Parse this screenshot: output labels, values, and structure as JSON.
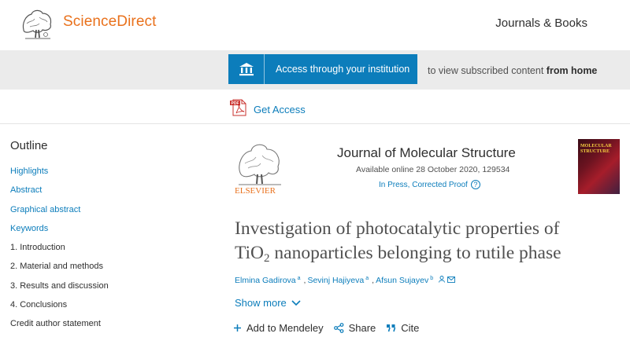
{
  "header": {
    "brand": "ScienceDirect",
    "journals_link": "Journals & Books"
  },
  "access": {
    "button_label": "Access through your institution",
    "note_prefix": "to view subscribed content",
    "note_bold": "from home"
  },
  "get_access": {
    "label": "Get Access"
  },
  "outline": {
    "title": "Outline",
    "items": [
      {
        "label": "Highlights",
        "style": "link"
      },
      {
        "label": "Abstract",
        "style": "link"
      },
      {
        "label": "Graphical abstract",
        "style": "link"
      },
      {
        "label": "Keywords",
        "style": "link"
      },
      {
        "label": "1. Introduction",
        "style": "plain"
      },
      {
        "label": "2. Material and methods",
        "style": "plain"
      },
      {
        "label": "3. Results and discussion",
        "style": "plain"
      },
      {
        "label": "4. Conclusions",
        "style": "plain"
      },
      {
        "label": "Credit author statement",
        "style": "plain"
      }
    ]
  },
  "journal": {
    "publisher": "ELSEVIER",
    "title": "Journal of Molecular Structure",
    "available": "Available online 28 October 2020, 129534",
    "status": "In Press, Corrected Proof",
    "cover_title": "MOLECULAR STRUCTURE"
  },
  "article": {
    "title_line1": "Investigation of photocatalytic properties of",
    "title_line2_pre": "TiO",
    "title_line2_sub": "2",
    "title_line2_post": " nanoparticles belonging to rutile phase",
    "authors": [
      {
        "name": "Elmina Gadirova",
        "aff": "a"
      },
      {
        "name": "Sevinj Hajiyeva",
        "aff": "a"
      },
      {
        "name": "Afsun Sujayev",
        "aff": "b"
      }
    ],
    "show_more": "Show more"
  },
  "actions": {
    "mendeley": "Add to Mendeley",
    "share": "Share",
    "cite": "Cite"
  },
  "colors": {
    "brand_orange": "#e9711c",
    "link_blue": "#0c7dbb",
    "band_grey": "#ebebeb"
  }
}
